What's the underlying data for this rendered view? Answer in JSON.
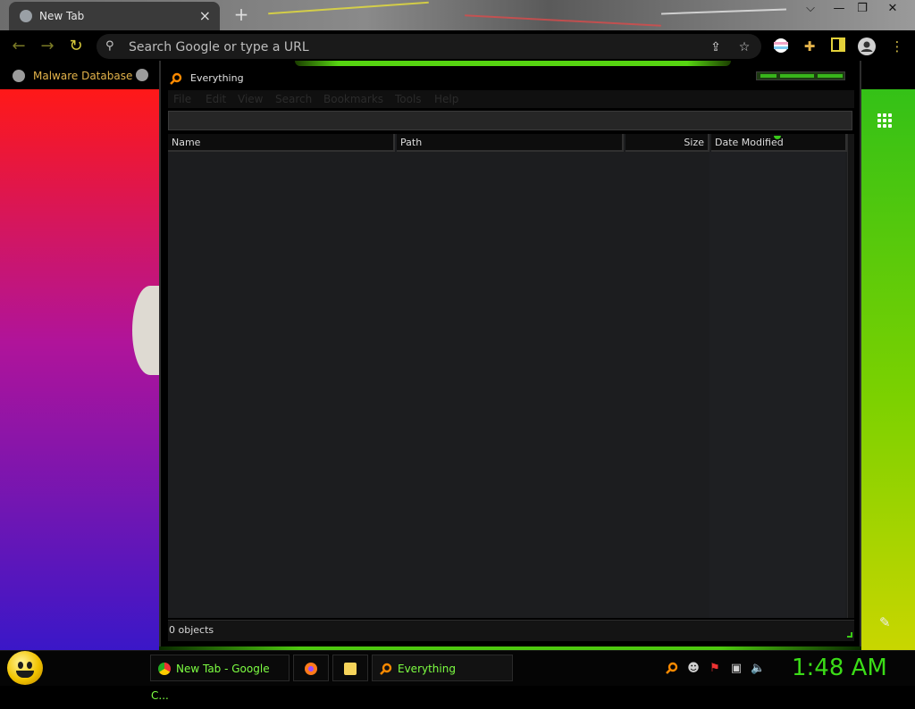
{
  "browser": {
    "tab_title": "New Tab",
    "tab_close_icon": "×",
    "new_tab_icon": "+",
    "window_controls": [
      "⌵",
      "—",
      "❐",
      "✕"
    ],
    "omnibox_placeholder": "Search Google or type a URL",
    "bookmarks": [
      {
        "label": "Malware Database"
      }
    ]
  },
  "everything_app": {
    "title": "Everything",
    "menu": [
      "File",
      "Edit",
      "View",
      "Search",
      "Bookmarks",
      "Tools",
      "Help"
    ],
    "columns": [
      "Name",
      "Path",
      "Size",
      "Date Modified"
    ],
    "status": "0 objects"
  },
  "taskbar": {
    "tasks": [
      {
        "label": "New Tab - Google C..."
      },
      {
        "label": ""
      },
      {
        "label": ""
      },
      {
        "label": "Everything"
      }
    ],
    "clock": "1:48 AM"
  },
  "colors": {
    "accent_green": "#3bdc17",
    "bookmark_text": "#e3b34a"
  }
}
